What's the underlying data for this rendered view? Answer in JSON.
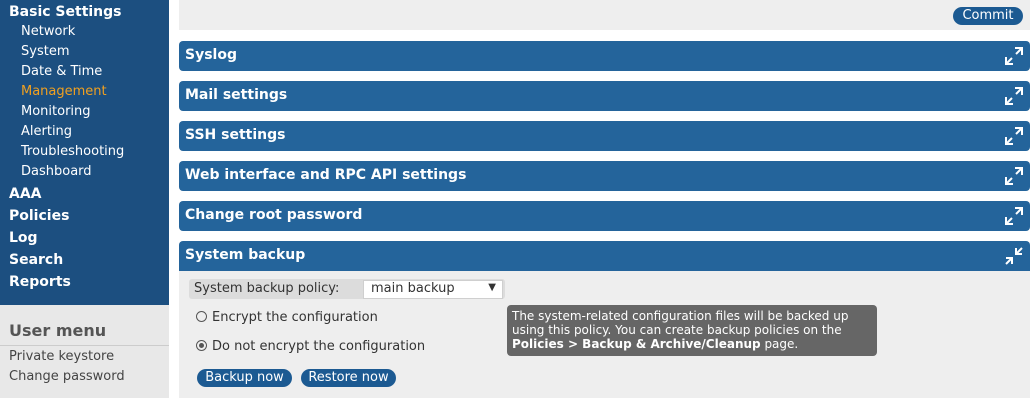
{
  "sidebar": {
    "basic_settings": "Basic Settings",
    "sub_items": [
      "Network",
      "System",
      "Date & Time",
      "Management",
      "Monitoring",
      "Alerting",
      "Troubleshooting",
      "Dashboard"
    ],
    "active_item": "Management",
    "top_items": [
      "AAA",
      "Policies",
      "Log",
      "Search",
      "Reports"
    ],
    "user_menu": {
      "title": "User menu",
      "items": [
        "Private keystore",
        "Change password"
      ]
    }
  },
  "main": {
    "commit_label": "Commit",
    "panels": [
      "Syslog",
      "Mail settings",
      "SSH settings",
      "Web interface and RPC API settings",
      "Change root password",
      "System backup"
    ],
    "backup": {
      "policy_label": "System backup policy:",
      "policy_value": "main backup",
      "encrypt_label": "Encrypt the configuration",
      "no_encrypt_label": "Do not encrypt the configuration",
      "tooltip_text": "The system-related configuration files will be backed up using this policy. You can create backup policies on the",
      "tooltip_bold": "Policies > Backup & Archive/Cleanup",
      "tooltip_end": " page.",
      "backup_now": "Backup now",
      "restore_now": "Restore now"
    }
  },
  "colors": {
    "nav_bg": "#1c4f80",
    "panel_bg": "#24649b",
    "active": "#f0a020"
  },
  "icons": {
    "expand": "expand-arrows-icon",
    "collapse": "collapse-arrows-icon"
  }
}
